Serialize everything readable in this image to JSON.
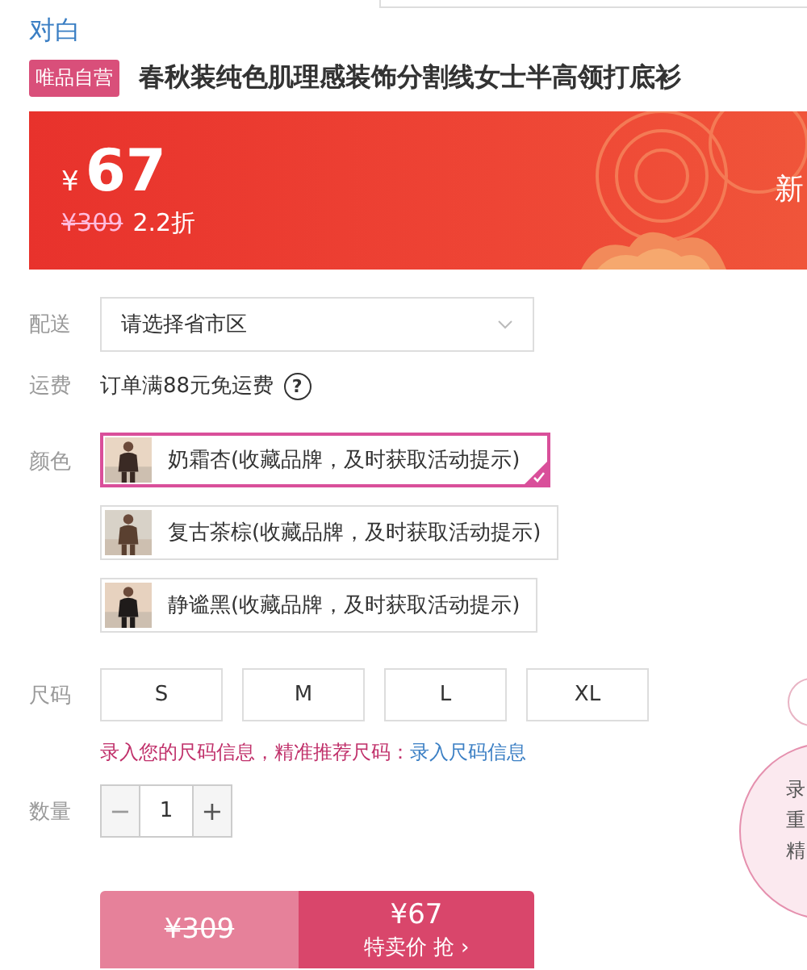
{
  "brand": "对白",
  "product": {
    "badge": "唯品自营",
    "title": "春秋装纯色肌理感装饰分割线女士半高领打底衫"
  },
  "banner": {
    "currency": "¥",
    "price": "67",
    "original_price": "¥309",
    "discount": "2.2折",
    "side_text": "新"
  },
  "delivery": {
    "label": "配送",
    "placeholder": "请选择省市区"
  },
  "shipping": {
    "label": "运费",
    "text": "订单满88元免运费",
    "help": "?"
  },
  "colors": {
    "label": "颜色",
    "options": [
      {
        "name": "奶霜杏(收藏品牌，及时获取活动提示)",
        "selected": true,
        "kind": "picture"
      },
      {
        "name": "复古茶棕(收藏品牌，及时获取活动提示)",
        "selected": false,
        "kind": "picture"
      },
      {
        "name": "静谧黑(收藏品牌，及时获取活动提示)",
        "selected": false,
        "kind": "picture"
      }
    ]
  },
  "sizes": {
    "label": "尺码",
    "options": [
      {
        "name": "S",
        "selected": false
      },
      {
        "name": "M",
        "selected": false
      },
      {
        "name": "L",
        "selected": false
      },
      {
        "name": "XL",
        "selected": false
      }
    ],
    "hint": "录入您的尺码信息，精准推荐尺码：",
    "hint_link": "录入尺码信息"
  },
  "quantity": {
    "label": "数量",
    "minus": "−",
    "value": "1",
    "plus": "+",
    "minus_disabled": true
  },
  "buy": {
    "original_price": "¥309",
    "price": "¥67",
    "action": "特卖价 抢 ›"
  },
  "bubble": {
    "lines": [
      "录",
      "重",
      "精"
    ]
  }
}
